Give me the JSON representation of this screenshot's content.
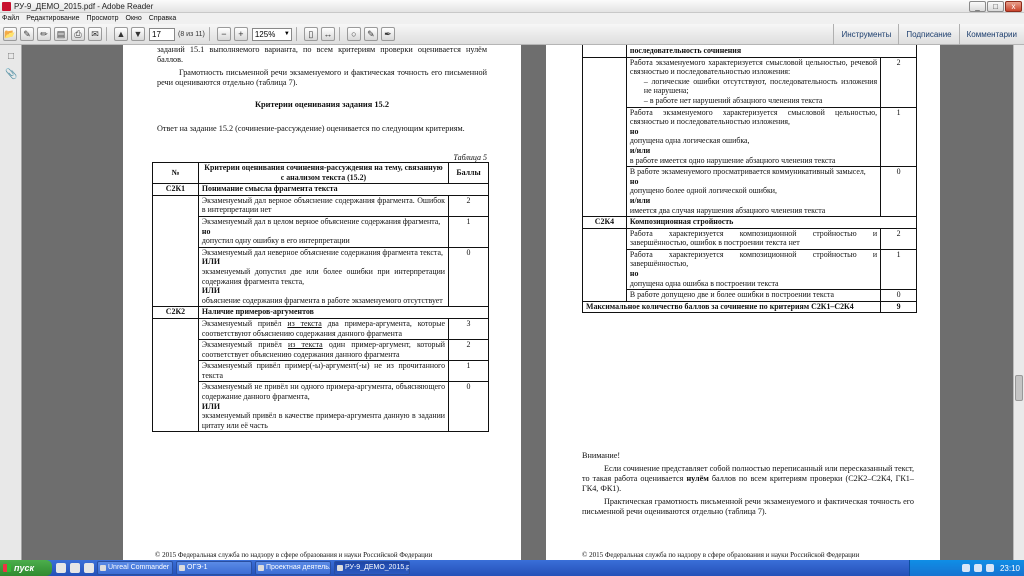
{
  "window": {
    "title": "РУ-9_ДЕМО_2015.pdf - Adobe Reader",
    "minimize": "_",
    "maximize": "□",
    "close": "x"
  },
  "menu": [
    "Файл",
    "Редактирование",
    "Просмотр",
    "Окно",
    "Справка"
  ],
  "toolbar": {
    "page_value": "17",
    "page_count": "(8 из 11)",
    "zoom_value": "125%",
    "tools_label": "Инструменты",
    "sign_label": "Подписание",
    "comment_label": "Комментарии"
  },
  "page1": {
    "intro1": "заданий 15.1 выполняемого варианта, по всем критериям проверки оценивается нулём баллов.",
    "intro2": "Грамотность письменной речи экзаменуемого и фактическая точность его письменной речи оцениваются отдельно (таблица 7).",
    "heading": "Критерии оценивания задания 15.2",
    "answer_text": "Ответ на задание 15.2 (сочинение-рассуждение) оценивается по следующим критериям.",
    "table_caption": "Таблица 5",
    "headers": {
      "num": "№",
      "crit": "Критерии оценивания сочинения-рассуждения на тему, связанную с анализом текста (15.2)",
      "score": "Баллы"
    },
    "k1": {
      "code": "С2К1",
      "title": "Понимание смысла фрагмента текста",
      "r1": {
        "text": "Экзаменуемый дал верное объяснение содержания фрагмента. Ошибок в интерпретации нет",
        "score": "2"
      },
      "r2": {
        "a": "Экзаменуемый дал в целом верное объяснение содержания фрагмента,",
        "conj": "но",
        "b": "допустил одну ошибку в его интерпретации",
        "score": "1"
      },
      "r3": {
        "a": "Экзаменуемый дал неверное объяснение содержания фрагмента текста,",
        "conj1": "ИЛИ",
        "b": "экзаменуемый допустил две или более ошибки при интерпретации содержания фрагмента текста,",
        "conj2": "ИЛИ",
        "c": "объяснение содержания фрагмента в работе экзаменуемого отсутствует",
        "score": "0"
      }
    },
    "k2": {
      "code": "С2К2",
      "title": "Наличие примеров-аргументов",
      "r1": {
        "pre": "Экзаменуемый привёл ",
        "link": "из текста",
        "post": " два примера-аргумента, которые соответствуют объяснению содержания данного фрагмента",
        "score": "3"
      },
      "r2": {
        "pre": "Экзаменуемый привёл ",
        "link": "из текста",
        "post": " один пример-аргумент, который соответствует объяснению содержания данного фрагмента",
        "score": "2"
      },
      "r3": {
        "text": "Экзаменуемый привёл пример(-ы)-аргумент(-ы) не из прочитанного текста",
        "score": "1"
      },
      "r4": {
        "a": "Экзаменуемый не привёл ни одного примера-аргумента, объясняющего содержание данного фрагмента,",
        "conj": "ИЛИ",
        "b": "экзаменуемый привёл в качестве примера-аргумента данную в задании цитату или её часть",
        "score": "0"
      }
    },
    "footer": "© 2015 Федеральная служба по надзору в сфере образования и науки Российской Федерации"
  },
  "page2": {
    "top_title": "последовательность сочинения",
    "k3": {
      "r1": {
        "text": "Работа экзаменуемого характеризуется смысловой цельностью, речевой связностью и последовательностью изложения:",
        "b1": "– логические ошибки отсутствуют, последовательность изложения не нарушена;",
        "b2": "– в работе нет нарушений абзацного членения текста",
        "score": "2"
      },
      "r2": {
        "a": "Работа экзаменуемого характеризуется смысловой цельностью, связностью и последовательностью изложения,",
        "conj1": "но",
        "b": "допущена одна логическая ошибка,",
        "conj2": "и/или",
        "c": "в работе имеется одно нарушение абзацного членения текста",
        "score": "1"
      },
      "r3": {
        "a": "В работе экзаменуемого просматривается коммуникативный замысел,",
        "conj1": "но",
        "b": "допущено более одной логической ошибки,",
        "conj2": "и/или",
        "c": "имеется два случая нарушения абзацного членения текста",
        "score": "0"
      }
    },
    "k4": {
      "code": "С2К4",
      "title": "Композиционная стройность",
      "r1": {
        "text": "Работа характеризуется композиционной стройностью и завершённостью, ошибок в построении текста нет",
        "score": "2"
      },
      "r2": {
        "a": "Работа характеризуется композиционной стройностью и завершённостью,",
        "conj": "но",
        "b": "допущена одна ошибка в построении текста",
        "score": "1"
      },
      "r3": {
        "text": "В работе допущено две и более ошибки в построении текста",
        "score": "0"
      }
    },
    "max_row": {
      "text": "Максимальное количество баллов за сочинение по критериям С2К1–С2К4",
      "score": "9"
    },
    "attention": "Внимание!",
    "note1_pre": "Если сочинение представляет собой полностью переписанный или пересказанный текст, то такая работа оценивается ",
    "note1_bold": "нулём",
    "note1_post": " баллов по всем критериям проверки (С2К2–С2К4, ГК1–ГК4, ФК1).",
    "note2": "Практическая грамотность письменной речи экзаменуемого и фактическая точность его письменной речи оцениваются отдельно (таблица 7).",
    "footer": "© 2015 Федеральная служба по надзору в сфере образования и науки Российской Федерации"
  },
  "taskbar": {
    "start": "пуск",
    "tasks": [
      "Unreal Commander",
      "ОГЭ-1",
      "Проектная деятель...",
      "РУ-9_ДЕМО_2015.p..."
    ],
    "clock": "23:10"
  }
}
